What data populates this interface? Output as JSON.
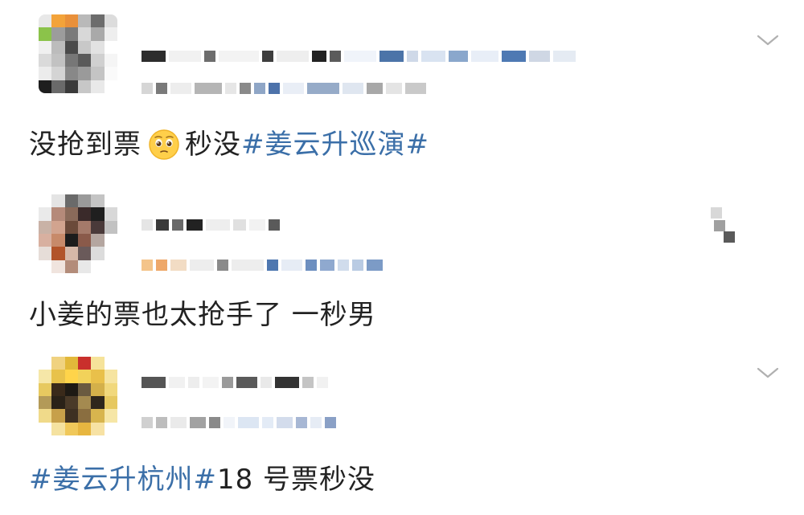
{
  "posts": [
    {
      "text_prefix": "没抢到票",
      "emoji_icon": "pleading-face-emoji",
      "text_middle": "秒没",
      "hashtag": "#姜云升巡演#",
      "text_suffix": ""
    },
    {
      "text_prefix": "小姜的票也太抢手了 一秒男"
    },
    {
      "hashtag": "#姜云升杭州#",
      "text_suffix": "18 号票秒没"
    }
  ],
  "icons": {
    "more": "chevron-down-icon"
  },
  "colors": {
    "hashtag": "#3b6fa8",
    "text": "#222222",
    "chevron": "#b0b0b0"
  }
}
